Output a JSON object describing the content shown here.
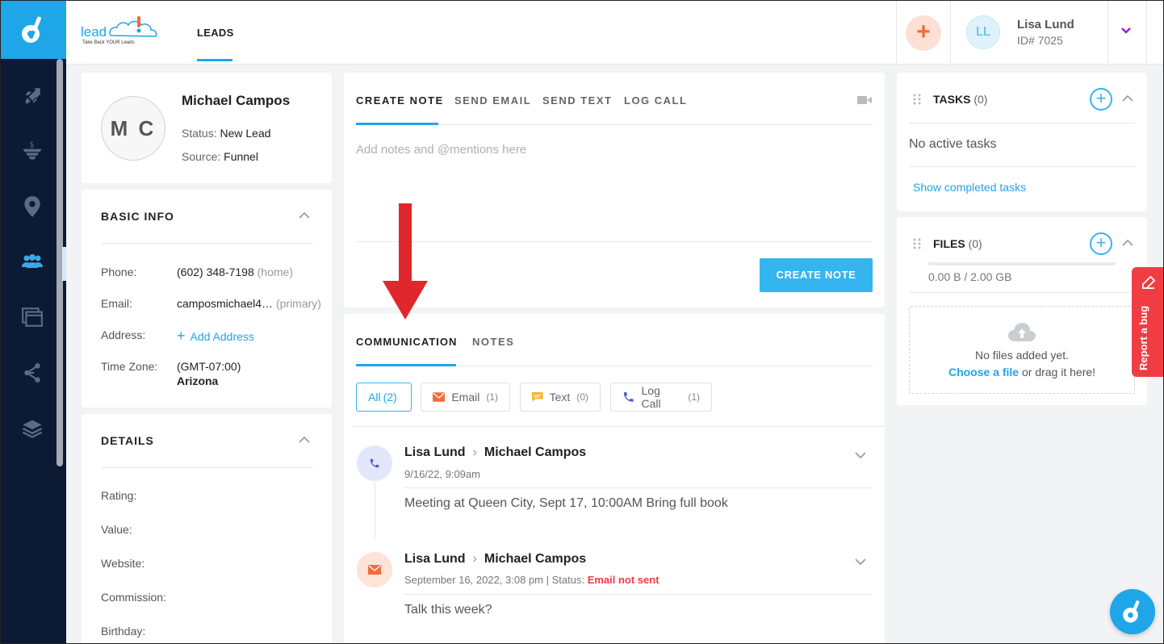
{
  "header": {
    "brand_word": "lead",
    "brand_tagline": "Take Back YOUR Leads",
    "active_tab": "LEADS",
    "user": {
      "initials": "LL",
      "name": "Lisa Lund",
      "id_text": "ID# 7025"
    }
  },
  "sidebar": {
    "items": [
      "rocket-icon",
      "funnel-icon",
      "location-pin-icon",
      "contacts-icon",
      "browser-windows-icon",
      "network-icon",
      "layers-icon"
    ],
    "active": "contacts-icon"
  },
  "profile": {
    "initials": "M C",
    "name": "Michael Campos",
    "status_label": "Status:",
    "status_value": "New Lead",
    "source_label": "Source:",
    "source_value": "Funnel"
  },
  "basic_info": {
    "title": "BASIC INFO",
    "phone_label": "Phone:",
    "phone_value": "(602) 348-7198",
    "phone_type": "(home)",
    "email_label": "Email:",
    "email_value": "camposmichael4…",
    "email_type": "(primary)",
    "address_label": "Address:",
    "address_action": "Add Address",
    "timezone_label": "Time Zone:",
    "timezone_value": "(GMT-07:00)",
    "timezone_city": "Arizona"
  },
  "details": {
    "title": "DETAILS",
    "fields": [
      "Rating:",
      "Value:",
      "Website:",
      "Commission:",
      "Birthday:"
    ]
  },
  "note_composer": {
    "tabs": [
      "CREATE NOTE",
      "SEND EMAIL",
      "SEND TEXT",
      "LOG CALL"
    ],
    "active_tab": "CREATE NOTE",
    "placeholder": "Add notes and @mentions here",
    "submit_label": "CREATE NOTE"
  },
  "communication": {
    "tabs": [
      "COMMUNICATION",
      "NOTES"
    ],
    "active_tab": "COMMUNICATION",
    "filters": [
      {
        "label": "All",
        "count": "(2)"
      },
      {
        "label": "Email",
        "count": "(1)"
      },
      {
        "label": "Text",
        "count": "(0)"
      },
      {
        "label": "Log Call",
        "count": "(1)"
      }
    ],
    "entries": [
      {
        "type": "call",
        "from": "Lisa Lund",
        "to": "Michael Campos",
        "meta": "9/16/22, 9:09am",
        "status_label": "",
        "status_value": "",
        "body": "Meeting at Queen City, Sept 17, 10:00AM Bring full book"
      },
      {
        "type": "email",
        "from": "Lisa Lund",
        "to": "Michael Campos",
        "meta": "September 16, 2022, 3:08 pm | Status: ",
        "status_value": "Email not sent",
        "body": "Talk this week?"
      }
    ]
  },
  "tasks": {
    "title": "TASKS",
    "count": "(0)",
    "empty_text": "No active tasks",
    "link": "Show completed tasks"
  },
  "files": {
    "title": "FILES",
    "count": "(0)",
    "storage": "0.00 B / 2.00 GB",
    "storage_used_fraction": 0,
    "empty_text": "No files added yet.",
    "choose_link": "Choose a file",
    "drag_text": " or drag it here!"
  },
  "bug_report": {
    "label": "Report a bug"
  },
  "colors": {
    "accent": "#1fa6e9",
    "sidebar": "#0c1a33",
    "alert": "#ef3d43",
    "orange": "#f46a3a"
  }
}
